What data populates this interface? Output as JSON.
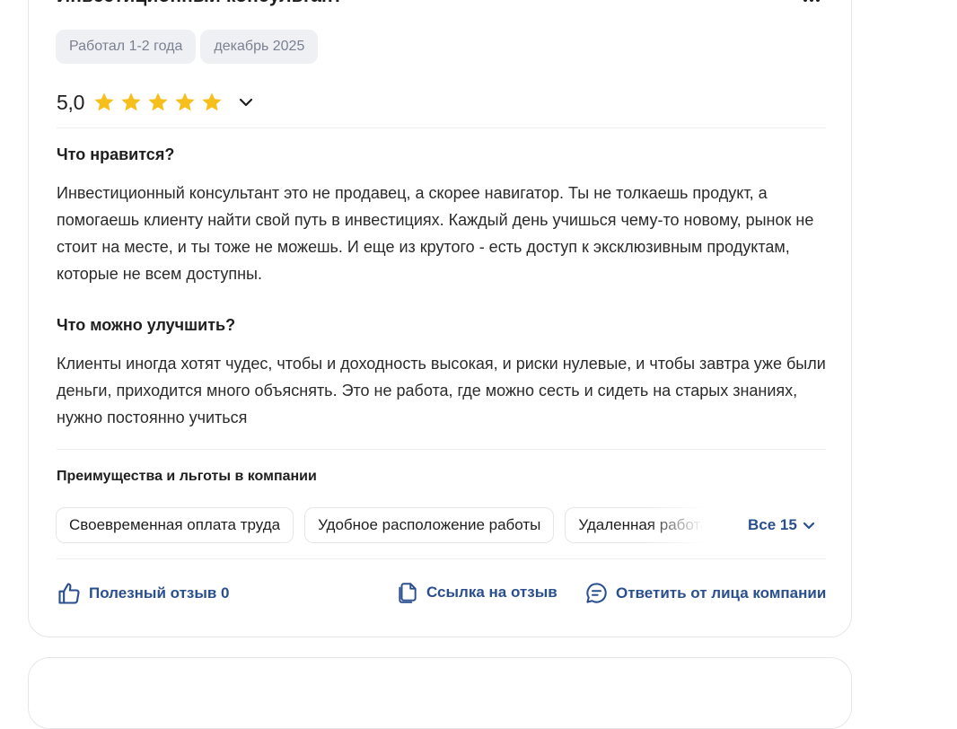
{
  "review": {
    "job_title": "Инвестиционный консультант",
    "tags": [
      "Работал 1-2 года",
      "декабрь 2025"
    ],
    "rating": {
      "value_text": "5,0",
      "score": 5,
      "max": 5,
      "star_color": "#f7bf1b"
    },
    "pros": {
      "title": "Что нравится?",
      "text": "Инвестиционный консультант это не продавец, а скорее навигатор. Ты не толкаешь продукт, а помогаешь клиенту найти свой путь в инвестициях. Каждый день учишься чему-то новому, рынок не стоит на месте, и ты тоже не можешь. И еще из крутого - есть доступ к эксклюзивным продуктам, которые не всем доступны."
    },
    "cons": {
      "title": "Что можно улучшить?",
      "text": "Клиенты иногда хотят чудес, чтобы и доходность высокая, и риски нулевые, и чтобы завтра уже были деньги, приходится много объяснять. Это не работа, где можно сесть и сидеть на старых знаниях, нужно постоянно учиться"
    },
    "benefits": {
      "title": "Преимущества и льготы в компании",
      "items": [
        "Своевременная оплата труда",
        "Удобное расположение работы",
        "Удаленная работа"
      ],
      "all_label": "Все 15"
    },
    "actions": {
      "useful_label": "Полезный отзыв 0",
      "link_label": "Ссылка на отзыв",
      "reply_label": "Ответить от лица компании"
    },
    "colors": {
      "accent": "#2a4f8f",
      "chip_bg": "#eef0f4",
      "chip_text": "#7b8190",
      "border": "#e4e6ea"
    }
  }
}
